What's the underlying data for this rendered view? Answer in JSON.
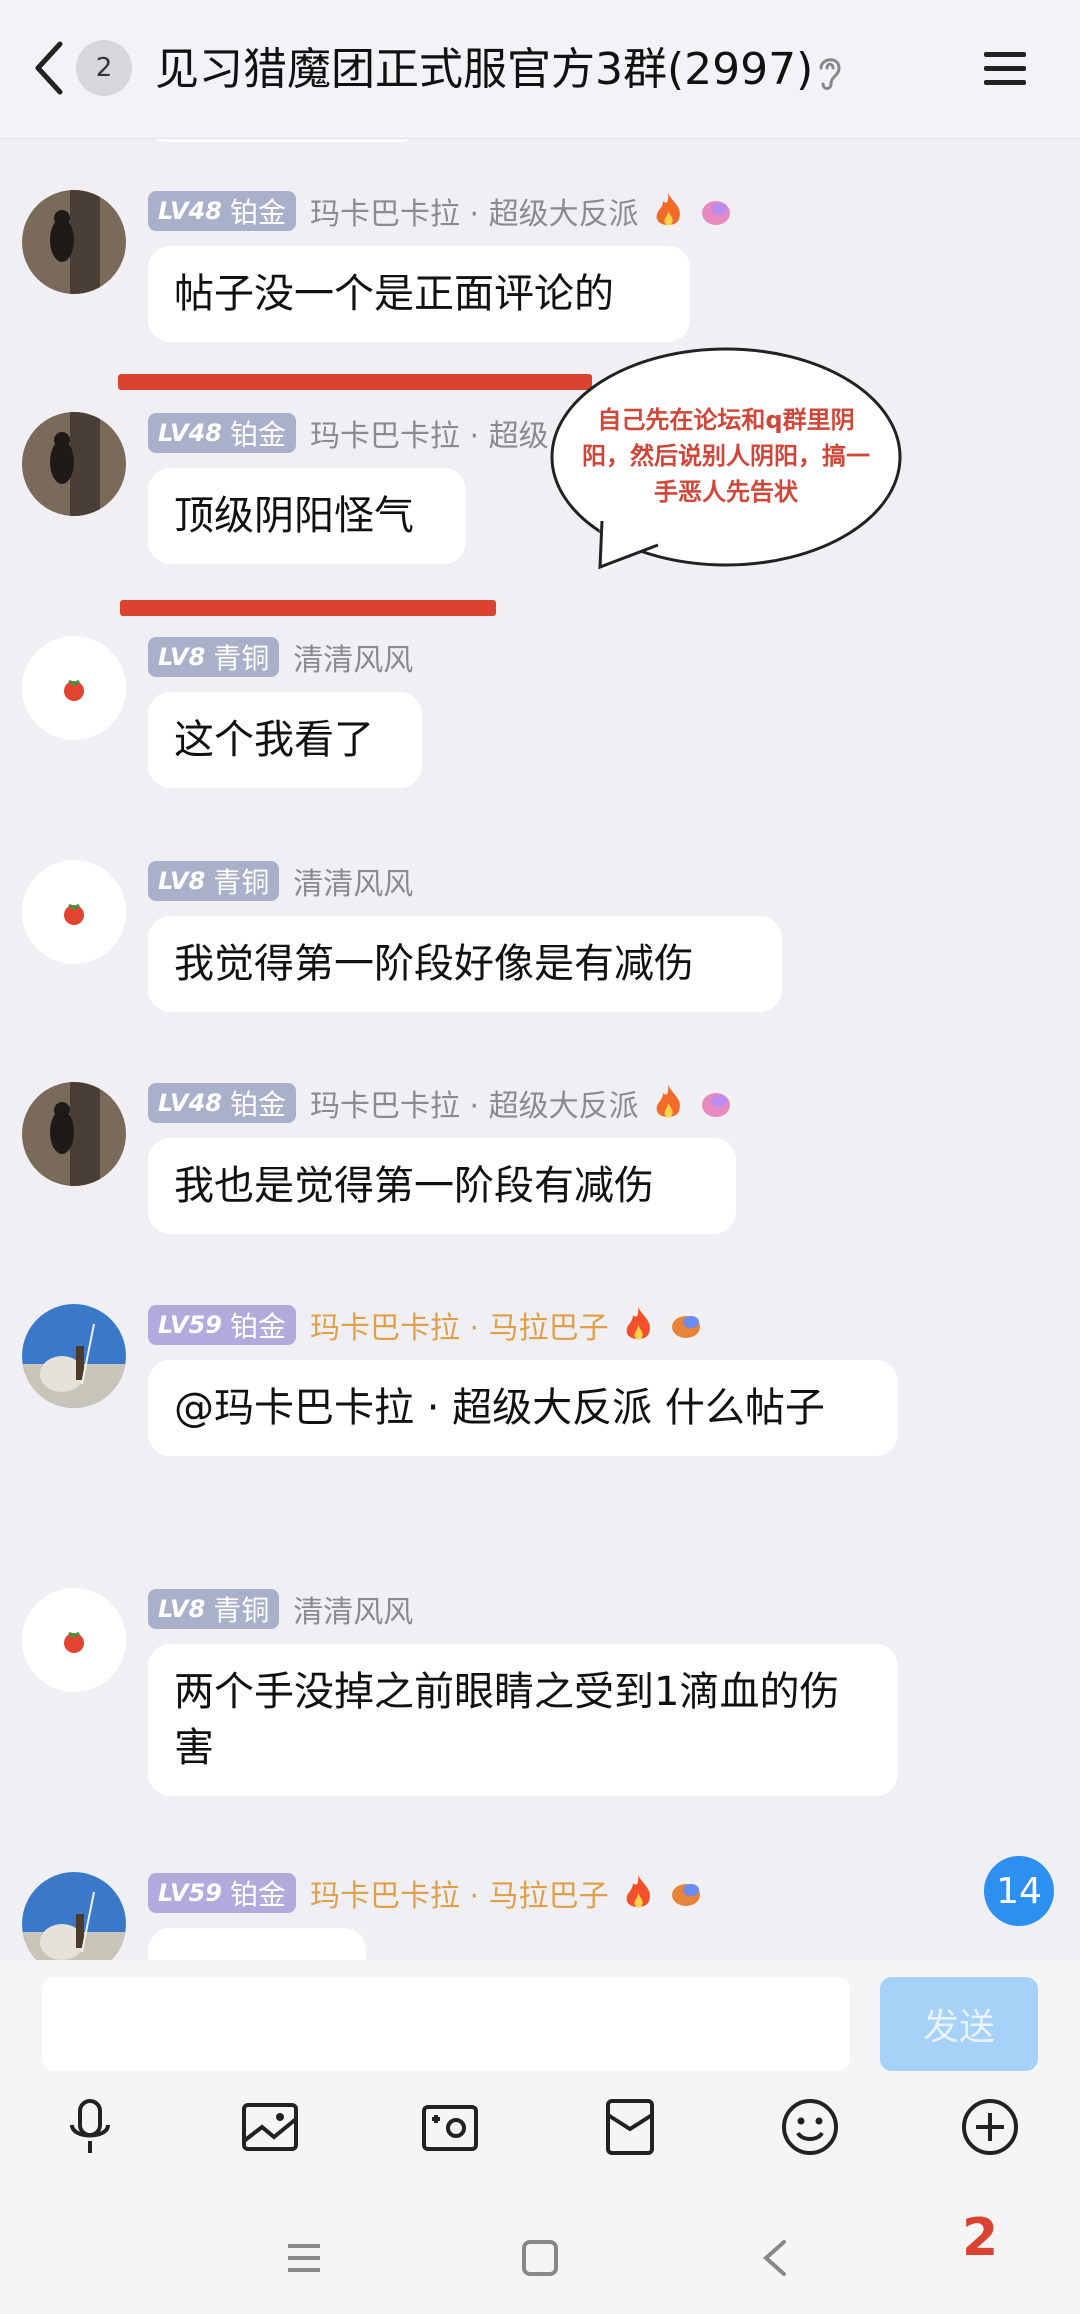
{
  "header": {
    "back_badge": "2",
    "title": "见习猎魔团正式服官方3群(2997)"
  },
  "messages": [
    {
      "level_num": "LV48",
      "level_name": "铂金",
      "nick": "玛卡巴卡拉 · 超级大反派",
      "text": "帖子没一个是正面评论的"
    },
    {
      "level_num": "LV48",
      "level_name": "铂金",
      "nick": "玛卡巴卡拉 · 超级",
      "text": "顶级阴阳怪气"
    },
    {
      "level_num": "LV8",
      "level_name": "青铜",
      "nick": "清清风风",
      "text": "这个我看了"
    },
    {
      "level_num": "LV8",
      "level_name": "青铜",
      "nick": "清清风风",
      "text": "我觉得第一阶段好像是有减伤"
    },
    {
      "level_num": "LV48",
      "level_name": "铂金",
      "nick": "玛卡巴卡拉 · 超级大反派",
      "text": "我也是觉得第一阶段有减伤"
    },
    {
      "level_num": "LV59",
      "level_name": "铂金",
      "nick": "玛卡巴卡拉 · 马拉巴子",
      "text": "@玛卡巴卡拉 · 超级大反派 什么帖子"
    },
    {
      "level_num": "LV8",
      "level_name": "青铜",
      "nick": "清清风风",
      "text": "两个手没掉之前眼睛之受到1滴血的伤害"
    },
    {
      "level_num": "LV59",
      "level_name": "铂金",
      "nick": "玛卡巴卡拉 · 马拉巴子",
      "text": ""
    }
  ],
  "annotation": {
    "text": "自己先在论坛和q群里阴阳，然后说别人阴阳，搞一手恶人先告状"
  },
  "unread_count": "14",
  "input": {
    "placeholder": "",
    "send_label": "发送"
  },
  "toolbar": {
    "icons": [
      "microphone-icon",
      "picture-icon",
      "camera-icon",
      "red-packet-icon",
      "emoji-icon",
      "plus-icon"
    ]
  },
  "corner_number": "2",
  "colors": {
    "accent": "#2d8ff0",
    "annotation_red": "#d9432f",
    "send_disabled": "#a6d2f7"
  }
}
